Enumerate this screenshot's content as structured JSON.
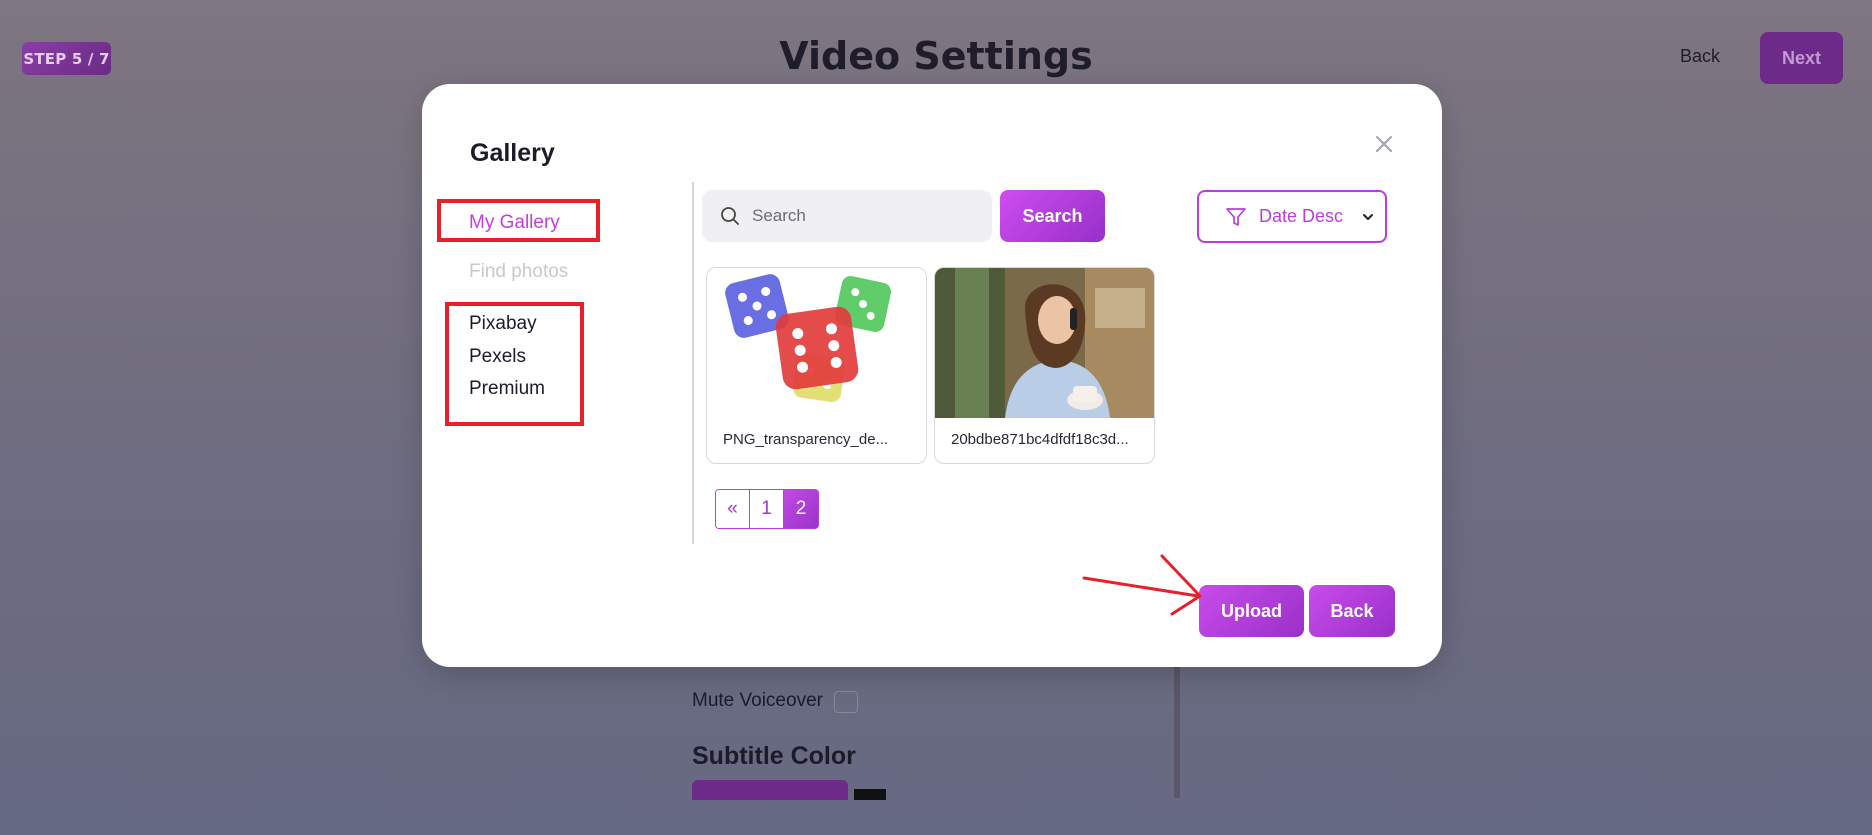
{
  "header": {
    "step_badge": "STEP 5 / 7",
    "title": "Video Settings",
    "back_label": "Back",
    "next_label": "Next"
  },
  "background": {
    "mute_voiceover_label": "Mute Voiceover",
    "mute_voiceover_checked": false,
    "subtitle_color_heading": "Subtitle Color"
  },
  "modal": {
    "title": "Gallery",
    "close_icon": "close-icon",
    "nav": {
      "my_gallery": "My Gallery",
      "find_photos": "Find photos",
      "sources": [
        "Pixabay",
        "Pexels",
        "Premium"
      ]
    },
    "search": {
      "placeholder": "Search",
      "value": "",
      "button_label": "Search"
    },
    "sort": {
      "selected": "Date Desc"
    },
    "items": [
      {
        "caption": "PNG_transparency_de..."
      },
      {
        "caption": "20bdbe871bc4dfdf18c3d..."
      }
    ],
    "pagination": {
      "prev": "«",
      "pages": [
        "1",
        "2"
      ],
      "current": "2"
    },
    "upload_label": "Upload",
    "back_label": "Back"
  },
  "colors": {
    "accent": "#b93ede",
    "annotation": "#e8202a"
  }
}
